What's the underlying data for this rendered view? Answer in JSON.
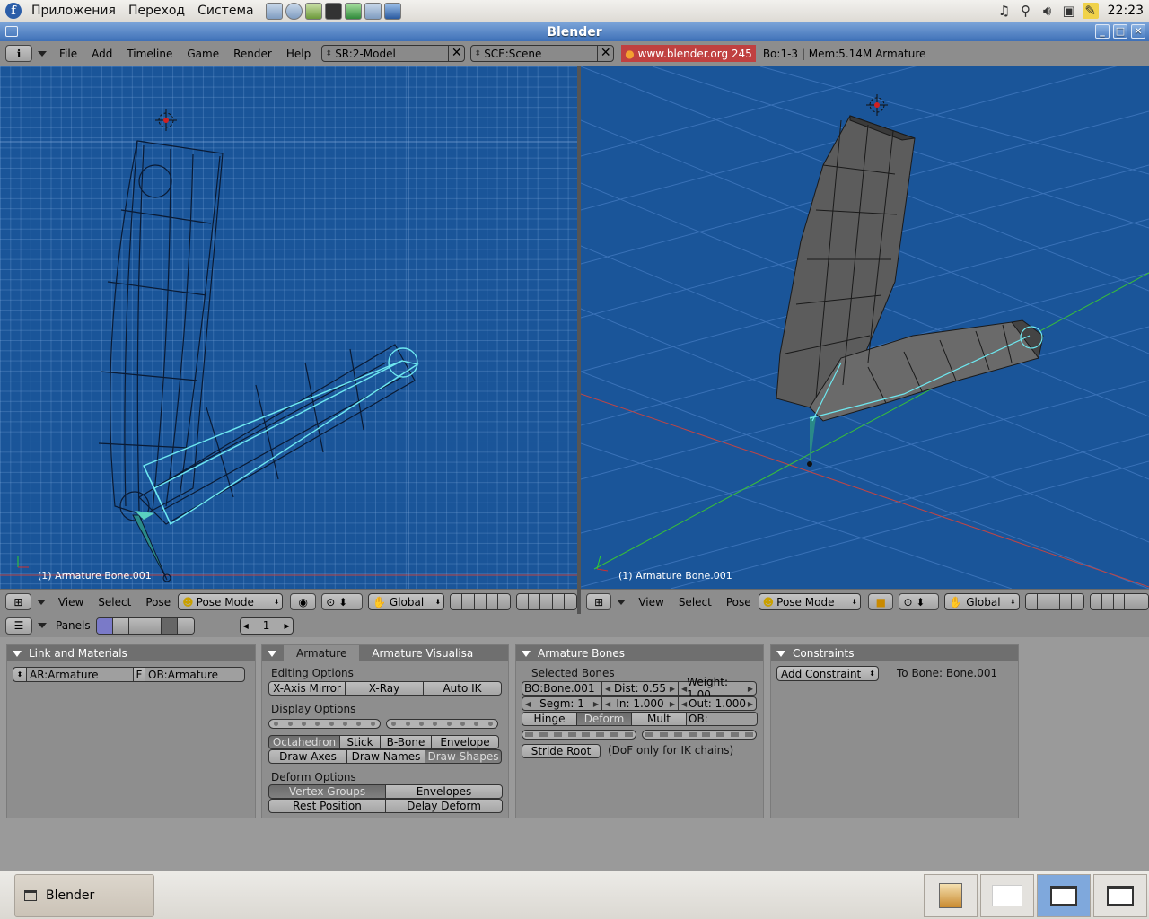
{
  "topbar": {
    "menu": [
      "Приложения",
      "Переход",
      "Система"
    ],
    "launchers": [
      "file-manager-icon",
      "web-browser-icon",
      "package-icon",
      "terminal-icon",
      "image-viewer-icon",
      "settings-icon",
      "monitor-icon"
    ],
    "tray": [
      "music-icon",
      "search-icon",
      "volume-icon",
      "network-icon",
      "notes-icon"
    ],
    "clock": "22:23"
  },
  "window": {
    "title": "Blender"
  },
  "header": {
    "menus": [
      "File",
      "Add",
      "Timeline",
      "Game",
      "Render",
      "Help"
    ],
    "screen_field": "SR:2-Model",
    "scene_field": "SCE:Scene",
    "url": "www.blender.org 245",
    "stats": "Bo:1-3  | Mem:5.14M Armature"
  },
  "viewport_left": {
    "label": "(1) Armature Bone.001"
  },
  "viewport_right": {
    "label": "(1) Armature Bone.001"
  },
  "view_header": {
    "menus": [
      "View",
      "Select",
      "Pose"
    ],
    "mode": "Pose Mode",
    "orientation": "Global"
  },
  "panels_header": {
    "label": "Panels",
    "frame": "1"
  },
  "link_materials": {
    "title": "Link and Materials",
    "ar_field": "AR:Armature",
    "f_label": "F",
    "ob_field": "OB:Armature"
  },
  "armature": {
    "tab_active": "Armature",
    "tab_other": "Armature Visualisa",
    "editing_label": "Editing Options",
    "editing": [
      "X-Axis Mirror",
      "X-Ray",
      "Auto IK"
    ],
    "display_label": "Display Options",
    "display_row1": [
      "Octahedron",
      "Stick",
      "B-Bone",
      "Envelope"
    ],
    "display_row2": [
      "Draw Axes",
      "Draw Names",
      "Draw Shapes"
    ],
    "deform_label": "Deform Options",
    "deform_row1": [
      "Vertex Groups",
      "Envelopes"
    ],
    "deform_row2": [
      "Rest Position",
      "Delay Deform"
    ]
  },
  "bones": {
    "title": "Armature Bones",
    "selected_label": "Selected Bones",
    "bone_name": "BO:Bone.001",
    "dist": "Dist: 0.55",
    "weight": "Weight: 1.00",
    "segm": "Segm: 1",
    "in": "In: 1.000",
    "out": "Out: 1.000",
    "flags": [
      "Hinge",
      "Deform",
      "Mult",
      "OB:"
    ],
    "stride_root": "Stride Root",
    "dof_note": "(DoF only for IK chains)"
  },
  "constraints": {
    "title": "Constraints",
    "add": "Add Constraint",
    "to_bone": "To Bone: Bone.001"
  },
  "taskbar": {
    "task": "Blender"
  },
  "colors": {
    "viewport": "#1a5599",
    "bone_highlight": "#6ee8f0",
    "panel_bg": "#8e8e8e"
  }
}
